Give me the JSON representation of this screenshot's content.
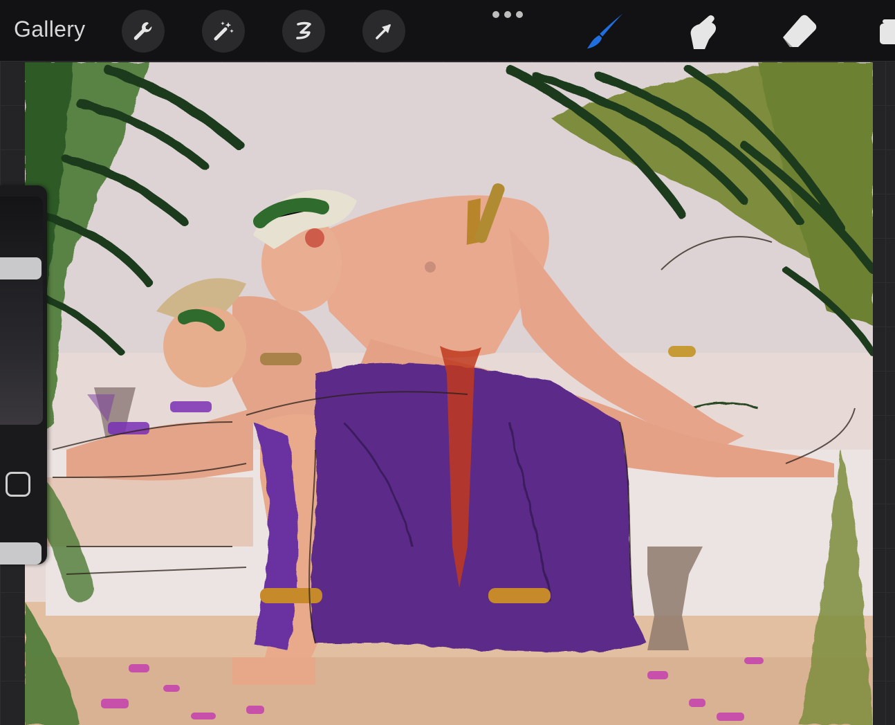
{
  "toolbar": {
    "gallery_label": "Gallery",
    "left_tools": [
      {
        "name": "actions",
        "icon": "wrench-icon"
      },
      {
        "name": "adjustments",
        "icon": "magic-wand-icon"
      },
      {
        "name": "selection",
        "icon": "selection-s-icon"
      },
      {
        "name": "transform",
        "icon": "arrow-cursor-icon"
      }
    ],
    "more_icon": "ellipsis-icon",
    "right_tools": [
      {
        "name": "brush",
        "icon": "brush-icon",
        "active": true
      },
      {
        "name": "smudge",
        "icon": "smudge-finger-icon"
      },
      {
        "name": "eraser",
        "icon": "eraser-icon"
      },
      {
        "name": "layers",
        "icon": "layers-icon"
      }
    ],
    "active_color": "#1f6fe0"
  },
  "sidebar": {
    "brush_size_slider": {
      "icon": "brush-size-slider"
    },
    "modify_button": {
      "icon": "square-modify-icon"
    },
    "opacity_slider": {
      "icon": "opacity-slider"
    }
  },
  "canvas": {
    "description_colors": {
      "background": "#e8dcd6",
      "foliage_dark": "#1f3a1c",
      "foliage_olive": "#7a8a3a",
      "drape_purple": "#5b2c86",
      "skin": "#e3a58a",
      "petals": "#c23fae",
      "blood": "#c0391f",
      "gold": "#b8852a"
    }
  }
}
